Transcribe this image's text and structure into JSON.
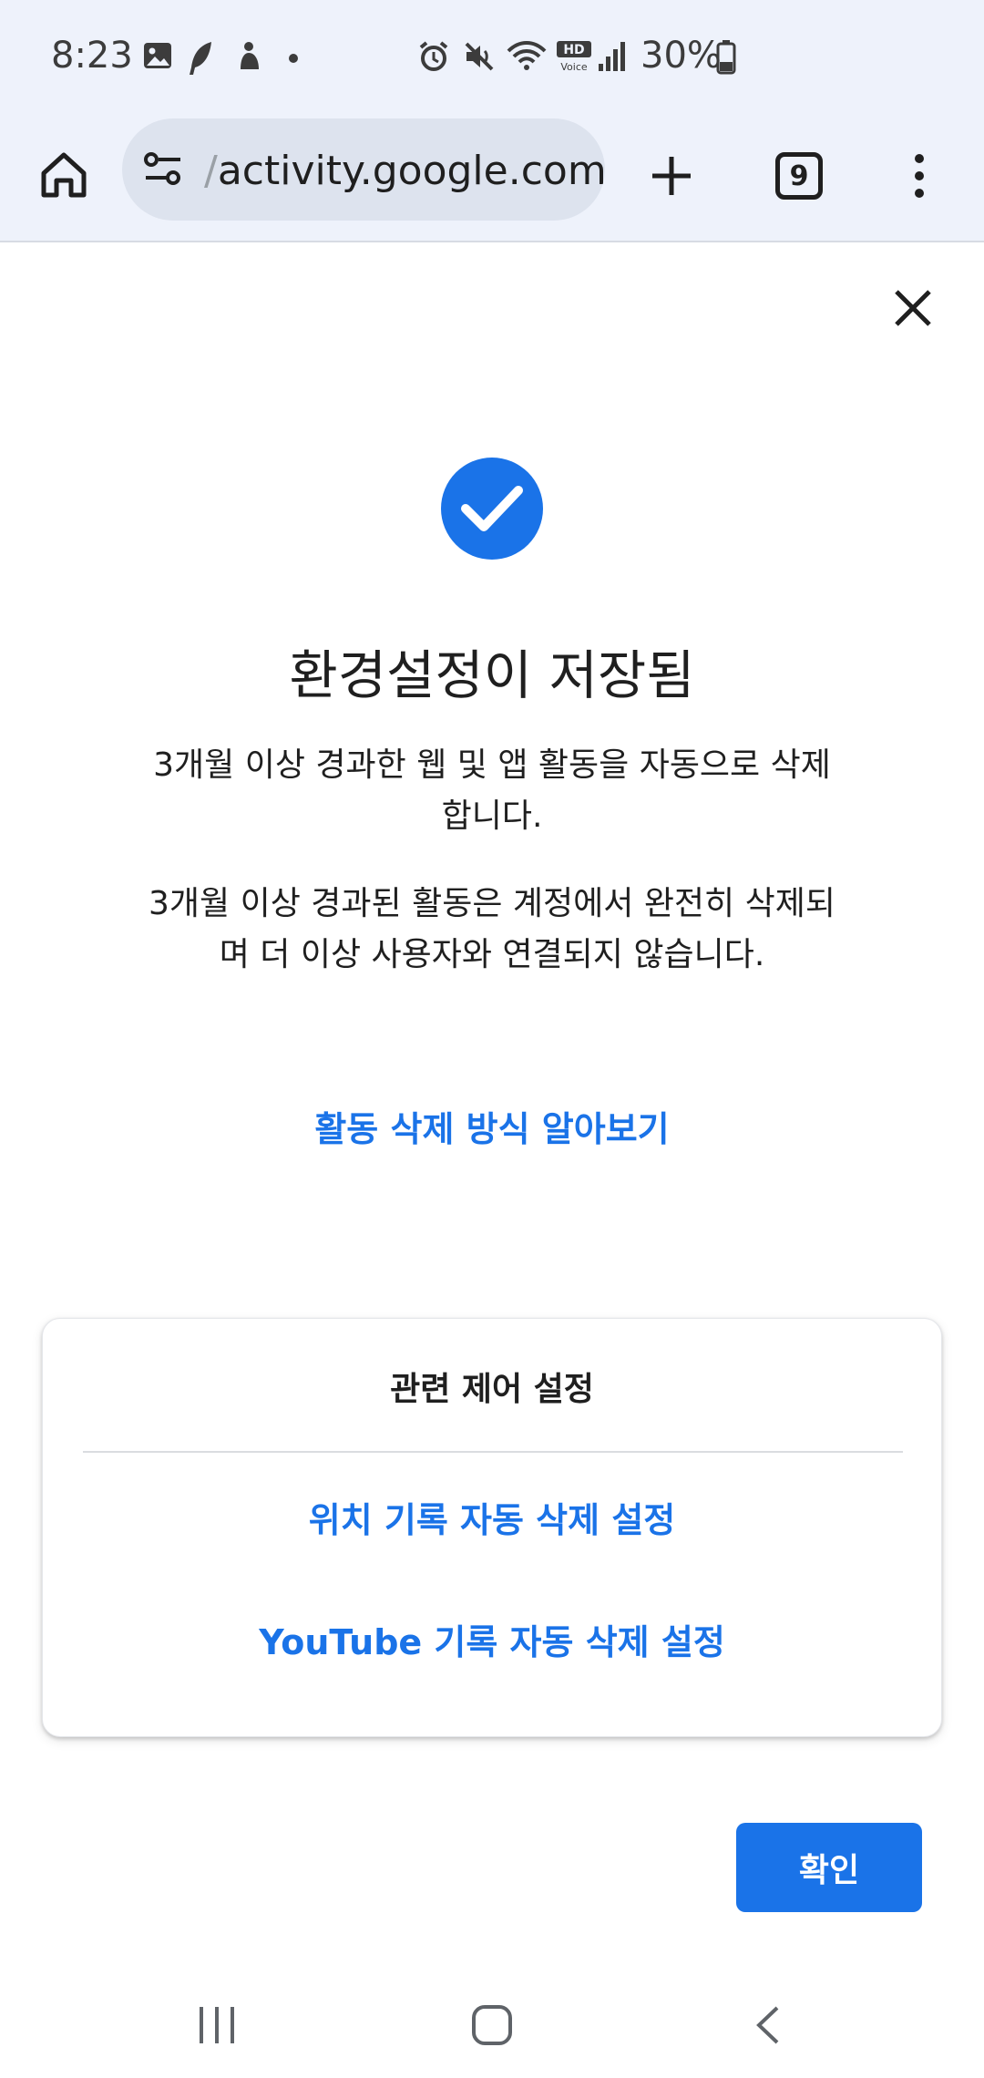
{
  "status_bar": {
    "time": "8:23",
    "battery": "30%",
    "icons": [
      "gallery-icon",
      "feather-icon",
      "app-icon",
      "dot-icon",
      "alarm-icon",
      "mute-icon",
      "wifi-icon",
      "hd-voice-icon",
      "signal-icon",
      "battery-icon"
    ]
  },
  "browser": {
    "url_faded": "/",
    "url": "activity.google.com",
    "tab_count": "9"
  },
  "page": {
    "title": "환경설정이 저장됨",
    "paragraph1": "3개월 이상 경과한 웹 및 앱 활동을 자동으로 삭제합니다.",
    "paragraph2": "3개월 이상 경과된 활동은 계정에서 완전히 삭제되며 더 이상 사용자와 연결되지 않습니다.",
    "learn_link": "활동 삭제 방식 알아보기",
    "card": {
      "title": "관련 제어 설정",
      "link1": "위치 기록 자동 삭제 설정",
      "link2": "YouTube 기록 자동 삭제 설정"
    },
    "confirm_label": "확인"
  },
  "colors": {
    "accent": "#1a73e8",
    "toolbar_bg": "#eef2fb"
  }
}
